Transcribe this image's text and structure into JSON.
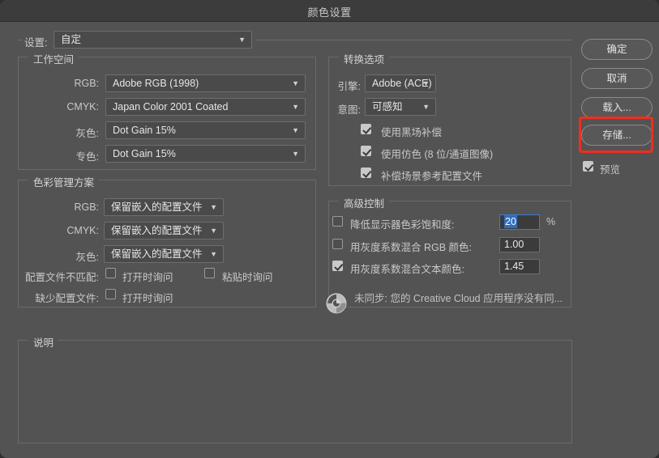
{
  "window": {
    "title": "颜色设置"
  },
  "settings_row": {
    "label": "设置:",
    "value": "自定"
  },
  "working_spaces": {
    "title": "工作空间",
    "rows": [
      {
        "label": "RGB:",
        "value": "Adobe RGB (1998)"
      },
      {
        "label": "CMYK:",
        "value": "Japan Color 2001 Coated"
      },
      {
        "label": "灰色:",
        "value": "Dot Gain 15%"
      },
      {
        "label": "专色:",
        "value": "Dot Gain 15%"
      }
    ]
  },
  "color_management_policies": {
    "title": "色彩管理方案",
    "rows": [
      {
        "label": "RGB:",
        "value": "保留嵌入的配置文件"
      },
      {
        "label": "CMYK:",
        "value": "保留嵌入的配置文件"
      },
      {
        "label": "灰色:",
        "value": "保留嵌入的配置文件"
      }
    ],
    "profile_mismatch": {
      "label": "配置文件不匹配:",
      "ask_when_opening": {
        "label": "打开时询问",
        "checked": false
      },
      "ask_when_pasting": {
        "label": "粘贴时询问",
        "checked": false
      }
    },
    "missing_profiles": {
      "label": "缺少配置文件:",
      "ask_when_opening": {
        "label": "打开时询问",
        "checked": false
      }
    }
  },
  "conversion_options": {
    "title": "转换选项",
    "engine": {
      "label": "引擎:",
      "value": "Adobe (ACE)"
    },
    "intent": {
      "label": "意图:",
      "value": "可感知"
    },
    "checkboxes": [
      {
        "label": "使用黑场补偿",
        "checked": true
      },
      {
        "label": "使用仿色 (8 位/通道图像)",
        "checked": true
      },
      {
        "label": "补偿场景参考配置文件",
        "checked": true
      }
    ]
  },
  "advanced_controls": {
    "title": "高级控制",
    "rows": [
      {
        "label": "降低显示器色彩饱和度:",
        "checked": false,
        "value": "20",
        "unit": "%",
        "focused": true
      },
      {
        "label": "用灰度系数混合 RGB 颜色:",
        "checked": false,
        "value": "1.00",
        "unit": "",
        "focused": false
      },
      {
        "label": "用灰度系数混合文本颜色:",
        "checked": true,
        "value": "1.45",
        "unit": "",
        "focused": false
      }
    ],
    "sync_status": "未同步: 您的 Creative Cloud 应用程序没有同..."
  },
  "description": {
    "title": "说明",
    "text": ""
  },
  "buttons": {
    "ok": "确定",
    "cancel": "取消",
    "load": "载入...",
    "save": "存储...",
    "preview": {
      "label": "预览",
      "checked": true
    }
  },
  "annotation": {
    "highlight_target": "存储...",
    "color": "#f12d1f"
  }
}
